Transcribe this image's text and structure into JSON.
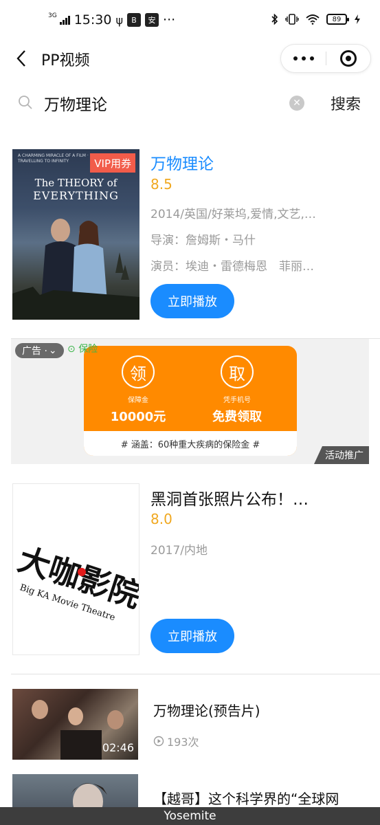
{
  "status_bar": {
    "network": "3G",
    "time": "15:30",
    "icon_app_1": "B",
    "icon_app_2": "安",
    "more": "···",
    "battery": "89"
  },
  "nav": {
    "title": "PP视频"
  },
  "search": {
    "query": "万物理论",
    "button_label": "搜索"
  },
  "results": [
    {
      "title": "万物理论",
      "rating": "8.5",
      "info": "2014/英国/好莱坞,爱情,文艺,…",
      "director": "导演：詹姆斯・马什",
      "cast": "演员：埃迪・雷德梅恩　菲丽…",
      "vip_badge": "VIP用券",
      "play_label": "立即播放",
      "poster": {
        "top_text": "A CHARMING MIRACLE OF A FILM · TRAVELLING TO INFINITY",
        "title_line1": "The THEORY of",
        "title_line2": "EVERYTHING"
      },
      "title_color": "#1a8cff"
    },
    {
      "title": "黑洞首张照片公布！…",
      "rating": "8.0",
      "info": "2017/内地",
      "play_label": "立即播放",
      "poster": {
        "logo_cn": "大咖影院",
        "logo_en": "Big KA Movie Theatre"
      }
    }
  ],
  "ad": {
    "badge": "广告 · ",
    "brand": "保险",
    "left_circle": "领",
    "left_small": "保障金",
    "left_big": "10000元",
    "right_circle": "取",
    "right_small": "凭手机号",
    "right_big": "免费领取",
    "footer": "# 涵盖：60种重大疾病的保险金 #",
    "promo": "活动推广"
  },
  "videos": [
    {
      "title": "万物理论(预告片)",
      "duration": "02:46",
      "views": "193次"
    },
    {
      "title": "【越哥】这个科学界的“全球网"
    }
  ],
  "taskbar": {
    "label": "Yosemite"
  },
  "colors": {
    "accent": "#1a8cff",
    "rating": "#f0a820",
    "ad_orange": "#ff8a00",
    "vip_red": "#f25c4a"
  }
}
